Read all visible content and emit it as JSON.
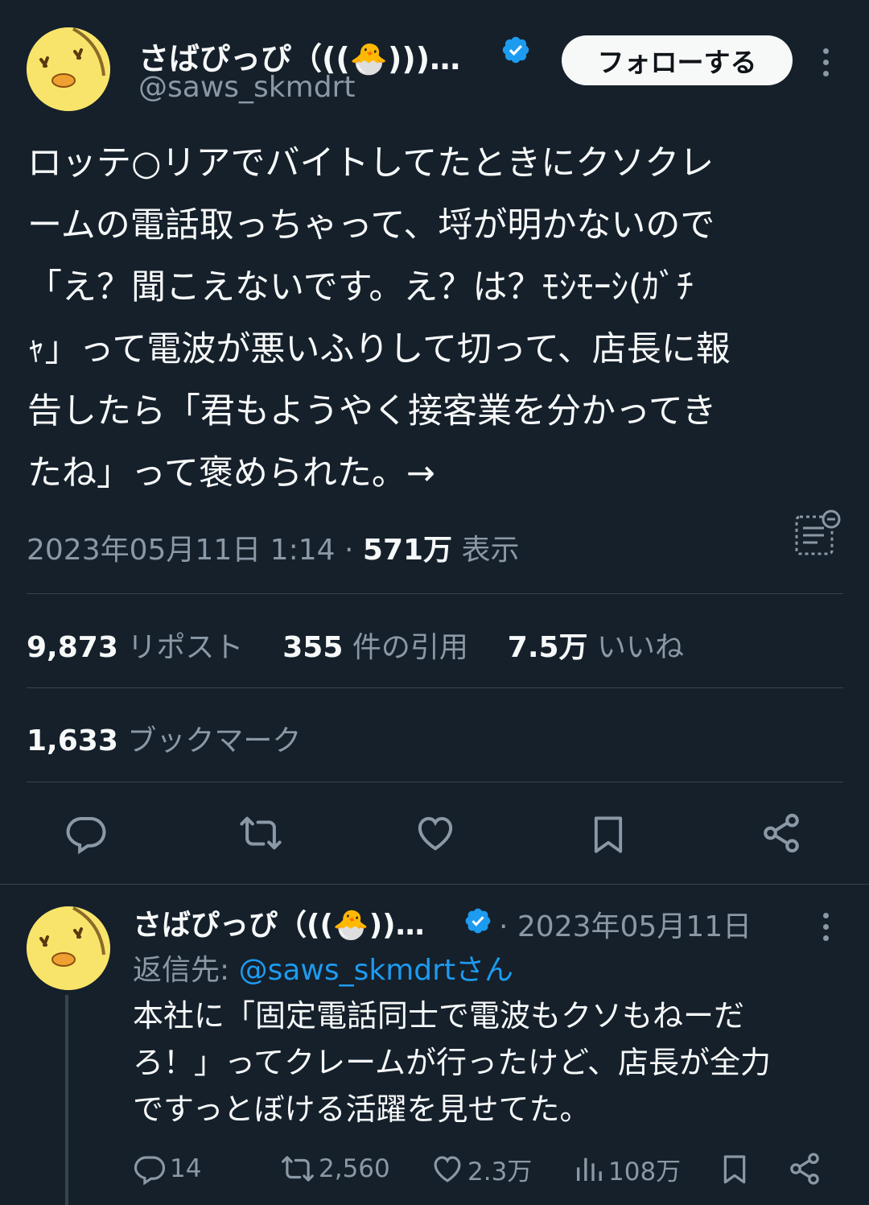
{
  "main_tweet": {
    "author_name": "さばぴっぴ（((🐣)))…",
    "handle": "@saws_skmdrt",
    "follow_label": "フォローする",
    "text_lines": [
      "ロッテ○リアでバイトしてたときにクソクレ",
      "ームの電話取っちゃって、埒が明かないので",
      "「え？聞こえないです。え？は？ﾓｼﾓｰｼ(ｶﾞﾁ",
      "ｬ」って電波が悪いふりして切って、店長に報",
      "告したら「君もようやく接客業を分かってき",
      "たね」って褒められた。→"
    ],
    "timestamp": "2023年05月11日 1:14",
    "separator": "·",
    "views_count": "571万",
    "views_label": "表示",
    "reposts_count": "9,873",
    "reposts_label": "リポスト",
    "quotes_count": "355",
    "quotes_label": "件の引用",
    "likes_count": "7.5万",
    "likes_label": "いいね",
    "bookmarks_count": "1,633",
    "bookmarks_label": "ブックマーク"
  },
  "reply_tweet": {
    "author_name": "さばぴっぴ（((🐣))…",
    "separator": "·",
    "date": "2023年05月11日",
    "reply_to_prefix": "返信先: ",
    "reply_to_handle": "@saws_skmdrtさん",
    "text_lines": [
      "本社に「固定電話同士で電波もクソもねーだ",
      "ろ！」ってクレームが行ったけど、店長が全力",
      "ですっとぼける活躍を見せてた。"
    ],
    "replies": "14",
    "reposts": "2,560",
    "likes": "2.3万",
    "views": "108万"
  },
  "colors": {
    "background": "#15202b",
    "text": "#f7f9f9",
    "muted": "#8b98a5",
    "accent": "#1d9bf0",
    "divider": "#38444d"
  },
  "icons": [
    "avatar-chick",
    "verified-badge",
    "more-icon",
    "analytics-icon",
    "reply-icon",
    "repost-icon",
    "like-icon",
    "bookmark-icon",
    "share-icon",
    "views-icon"
  ]
}
